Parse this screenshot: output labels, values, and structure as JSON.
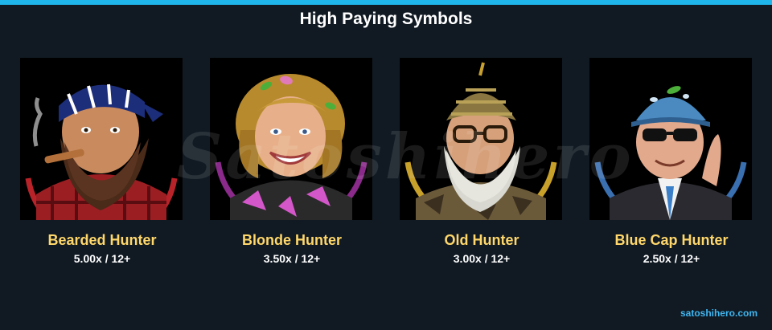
{
  "header": {
    "title": "High Paying Symbols",
    "accent_color": "#1fb6ec"
  },
  "watermark": "Satoshihero",
  "symbols": [
    {
      "name": "Bearded Hunter",
      "payout": "5.00x / 12+",
      "icon": "bearded-hunter-portrait",
      "frame_color": "#b8232a"
    },
    {
      "name": "Blonde Hunter",
      "payout": "3.50x / 12+",
      "icon": "blonde-hunter-portrait",
      "frame_color": "#8a2a8a"
    },
    {
      "name": "Old Hunter",
      "payout": "3.00x / 12+",
      "icon": "old-hunter-portrait",
      "frame_color": "#c8a12a"
    },
    {
      "name": "Blue Cap Hunter",
      "payout": "2.50x / 12+",
      "icon": "blue-cap-hunter-portrait",
      "frame_color": "#3a6fb0"
    }
  ],
  "footer": {
    "credit": "satoshihero.com",
    "credit_color": "#3fb6f0"
  },
  "colors": {
    "background": "#111a23",
    "name_text": "#ffd76a",
    "payout_text": "#ffffff"
  }
}
